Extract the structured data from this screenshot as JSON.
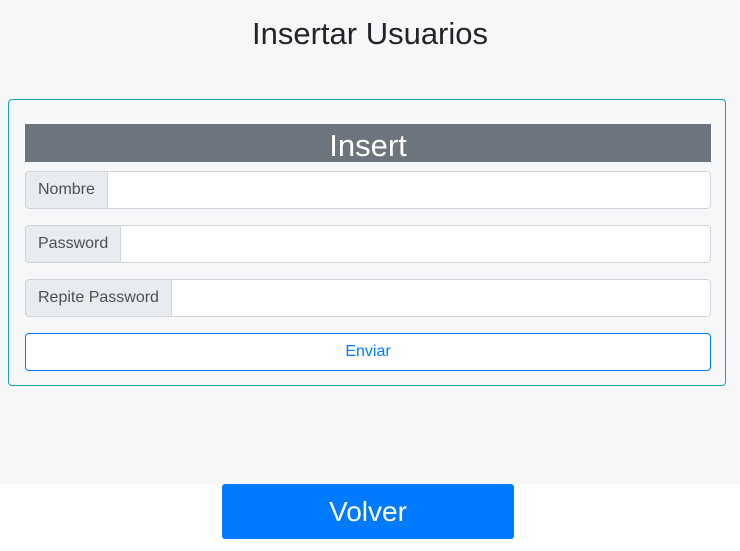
{
  "page": {
    "title": "Insertar Usuarios"
  },
  "form": {
    "header": "Insert",
    "fields": [
      {
        "label": "Nombre",
        "value": "",
        "placeholder": ""
      },
      {
        "label": "Password",
        "value": "",
        "placeholder": ""
      },
      {
        "label": "Repite Password",
        "value": "",
        "placeholder": ""
      }
    ],
    "submit_label": "Enviar"
  },
  "footer": {
    "back_label": "Volver"
  },
  "colors": {
    "card_border": "#17a2b8",
    "header_bg": "#6c757d",
    "primary": "#007bff",
    "addon_bg": "#e9ecef"
  }
}
